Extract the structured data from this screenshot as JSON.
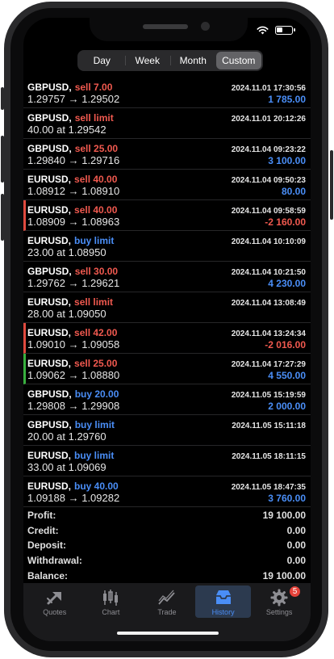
{
  "segments": [
    {
      "label": "Day",
      "active": false
    },
    {
      "label": "Week",
      "active": false
    },
    {
      "label": "Month",
      "active": false
    },
    {
      "label": "Custom",
      "active": true
    }
  ],
  "deals": [
    {
      "symbol": "GBPUSD,",
      "side": "sell 7.00",
      "type": "sell",
      "time": "2024.11.01 17:30:56",
      "prices": "1.29757 → 1.29502",
      "profit": "1 785.00",
      "profit_sign": "pos",
      "bar": ""
    },
    {
      "symbol": "GBPUSD,",
      "side": "sell limit",
      "type": "sell",
      "time": "2024.11.01 20:12:26",
      "prices": "40.00 at 1.29542",
      "profit": "",
      "profit_sign": "",
      "bar": ""
    },
    {
      "symbol": "GBPUSD,",
      "side": "sell 25.00",
      "type": "sell",
      "time": "2024.11.04 09:23:22",
      "prices": "1.29840 → 1.29716",
      "profit": "3 100.00",
      "profit_sign": "pos",
      "bar": ""
    },
    {
      "symbol": "EURUSD,",
      "side": "sell 40.00",
      "type": "sell",
      "time": "2024.11.04 09:50:23",
      "prices": "1.08912 → 1.08910",
      "profit": "80.00",
      "profit_sign": "pos",
      "bar": ""
    },
    {
      "symbol": "EURUSD,",
      "side": "sell 40.00",
      "type": "sell",
      "time": "2024.11.04 09:58:59",
      "prices": "1.08909 → 1.08963",
      "profit": "-2 160.00",
      "profit_sign": "neg",
      "bar": "red"
    },
    {
      "symbol": "EURUSD,",
      "side": "buy limit",
      "type": "buy",
      "time": "2024.11.04 10:10:09",
      "prices": "23.00 at 1.08950",
      "profit": "",
      "profit_sign": "",
      "bar": ""
    },
    {
      "symbol": "GBPUSD,",
      "side": "sell 30.00",
      "type": "sell",
      "time": "2024.11.04 10:21:50",
      "prices": "1.29762 → 1.29621",
      "profit": "4 230.00",
      "profit_sign": "pos",
      "bar": ""
    },
    {
      "symbol": "EURUSD,",
      "side": "sell limit",
      "type": "sell",
      "time": "2024.11.04 13:08:49",
      "prices": "28.00 at 1.09050",
      "profit": "",
      "profit_sign": "",
      "bar": ""
    },
    {
      "symbol": "EURUSD,",
      "side": "sell 42.00",
      "type": "sell",
      "time": "2024.11.04 13:24:34",
      "prices": "1.09010 → 1.09058",
      "profit": "-2 016.00",
      "profit_sign": "neg",
      "bar": "red"
    },
    {
      "symbol": "EURUSD,",
      "side": "sell 25.00",
      "type": "sell",
      "time": "2024.11.04 17:27:29",
      "prices": "1.09062 → 1.08880",
      "profit": "4 550.00",
      "profit_sign": "pos",
      "bar": "green"
    },
    {
      "symbol": "GBPUSD,",
      "side": "buy 20.00",
      "type": "buy",
      "time": "2024.11.05 15:19:59",
      "prices": "1.29808 → 1.29908",
      "profit": "2 000.00",
      "profit_sign": "pos",
      "bar": ""
    },
    {
      "symbol": "GBPUSD,",
      "side": "buy limit",
      "type": "buy",
      "time": "2024.11.05 15:11:18",
      "prices": "20.00 at 1.29760",
      "profit": "",
      "profit_sign": "",
      "bar": ""
    },
    {
      "symbol": "EURUSD,",
      "side": "buy limit",
      "type": "buy",
      "time": "2024.11.05 18:11:15",
      "prices": "33.00 at 1.09069",
      "profit": "",
      "profit_sign": "",
      "bar": ""
    },
    {
      "symbol": "EURUSD,",
      "side": "buy 40.00",
      "type": "buy",
      "time": "2024.11.05 18:47:35",
      "prices": "1.09188 → 1.09282",
      "profit": "3 760.00",
      "profit_sign": "pos",
      "bar": ""
    }
  ],
  "summary": [
    {
      "label": "Profit:",
      "value": "19 100.00"
    },
    {
      "label": "Credit:",
      "value": "0.00"
    },
    {
      "label": "Deposit:",
      "value": "0.00"
    },
    {
      "label": "Withdrawal:",
      "value": "0.00"
    },
    {
      "label": "Balance:",
      "value": "19 100.00"
    }
  ],
  "tabs": [
    {
      "label": "Quotes",
      "icon": "quotes-icon",
      "active": false
    },
    {
      "label": "Chart",
      "icon": "chart-icon",
      "active": false
    },
    {
      "label": "Trade",
      "icon": "trade-icon",
      "active": false
    },
    {
      "label": "History",
      "icon": "history-icon",
      "active": true
    },
    {
      "label": "Settings",
      "icon": "settings-icon",
      "active": false,
      "badge": "5"
    }
  ],
  "colors": {
    "sell": "#f0594f",
    "buy": "#4a8ef7",
    "profit_positive": "#4a8ef7",
    "profit_negative": "#f0594f",
    "active_tab": "#4a8ef7"
  }
}
